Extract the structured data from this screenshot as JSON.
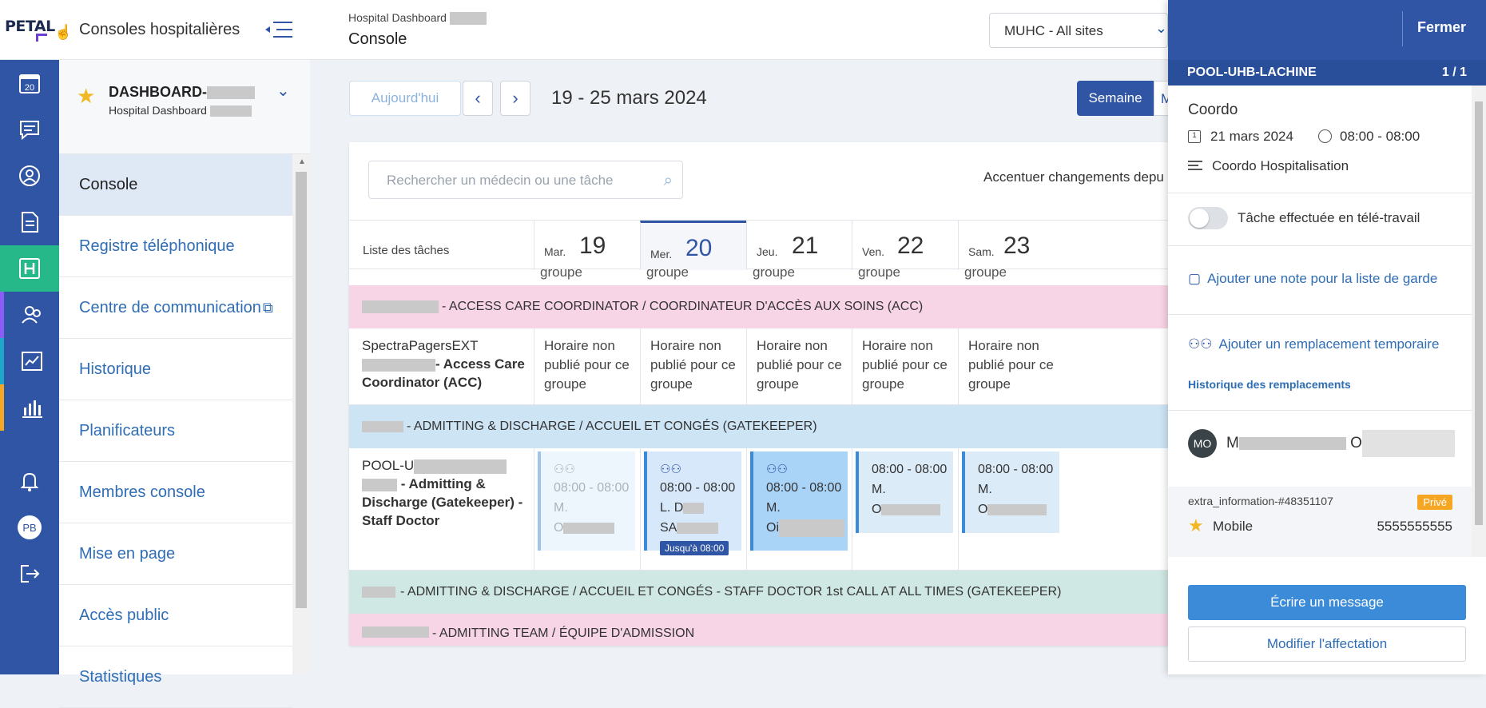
{
  "header": {
    "logo_text": "PETAL",
    "app_title": "Consoles hospitalières",
    "breadcrumb_small": "Hospital Dashboard",
    "breadcrumb_main": "Console",
    "site_select": "MUHC - All sites"
  },
  "sidebar": {
    "dashboard_name": "DASHBOARD-",
    "dashboard_sub": "Hospital Dashboard",
    "items": [
      {
        "label": "Console"
      },
      {
        "label": "Registre téléphonique"
      },
      {
        "label": "Centre de communication"
      },
      {
        "label": "Historique"
      },
      {
        "label": "Planificateurs"
      },
      {
        "label": "Membres console"
      },
      {
        "label": "Mise en page"
      },
      {
        "label": "Accès public"
      },
      {
        "label": "Statistiques"
      }
    ]
  },
  "rail": {
    "calendar_day": "20",
    "user_initials": "PB"
  },
  "toolbar": {
    "today": "Aujourd'hui",
    "date_range": "19 - 25 mars 2024",
    "week": "Semaine",
    "month": "M"
  },
  "grid": {
    "search_placeholder": "Rechercher un médecin ou une tâche",
    "accent_text": "Accentuer changements depu",
    "tasks_header": "Liste des tâches",
    "days": [
      {
        "name": "Mar.",
        "num": "19"
      },
      {
        "name": "Mer.",
        "num": "20"
      },
      {
        "name": "Jeu.",
        "num": "21"
      },
      {
        "name": "Ven.",
        "num": "22"
      },
      {
        "name": "Sam.",
        "num": "23"
      }
    ],
    "cut_text": "groupe",
    "band1": "- ACCESS CARE COORDINATOR / COORDINATEUR D'ACCÈS AUX SOINS (ACC)",
    "row1": {
      "line1": "SpectraPagersEXT",
      "bold": "- Access Care Coordinator (ACC)",
      "unpublished": [
        "Horaire non",
        "publié pour ce",
        "groupe"
      ]
    },
    "band2": "- ADMITTING & DISCHARGE / ACCUEIL ET CONGÉS (GATEKEEPER)",
    "row2": {
      "line1": "POOL-U",
      "bold": "- Admitting & Discharge (Gatekeeper) - Staff Doctor",
      "shifts": [
        {
          "time": "08:00 - 08:00",
          "l1": "M.",
          "l2": "O"
        },
        {
          "time": "08:00 - 08:00",
          "l1": "L. D",
          "l2": "SA",
          "badge": "Jusqu'à 08:00"
        },
        {
          "time": "08:00 - 08:00",
          "l1": "M.",
          "l2": "Oi"
        },
        {
          "time": "08:00 - 08:00",
          "l1": "M.",
          "l2": "O"
        },
        {
          "time": "08:00 - 08:00",
          "l1": "M.",
          "l2": "O"
        }
      ]
    },
    "band3": "- ADMITTING & DISCHARGE / ACCUEIL ET CONGÉS - STAFF DOCTOR 1st CALL AT ALL TIMES (GATEKEEPER)",
    "band4": "- ADMITTING TEAM / ÉQUIPE D'ADMISSION"
  },
  "panel": {
    "close": "Fermer",
    "pool": "POOL-UHB-LACHINE",
    "count": "1 / 1",
    "title": "Coordo",
    "date": "21 mars 2024",
    "time": "08:00 - 08:00",
    "description": "Coordo Hospitalisation",
    "toggle_label": "Tâche effectuée en télé-travail",
    "add_note": "Ajouter une note pour la liste de garde",
    "add_replacement": "Ajouter un remplacement temporaire",
    "history": "Historique des remplacements",
    "person_initials": "MO",
    "person_name_a": "M",
    "person_name_b": "O",
    "extra_key": "extra_information-#48351107",
    "private_badge": "Privé",
    "mobile_label": "Mobile",
    "mobile_number": "5555555555",
    "write_message": "Écrire un message",
    "modify": "Modifier l'affectation"
  }
}
